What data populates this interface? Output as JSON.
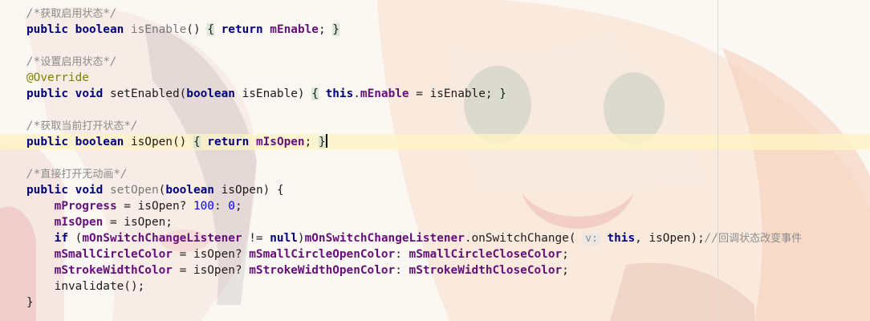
{
  "editor": {
    "language": "java",
    "current_line_index": 9,
    "lines": [
      {
        "tokens": [
          {
            "t": "/*",
            "c": "cmt"
          },
          {
            "t": "获取启用状态",
            "c": "cmt-cn"
          },
          {
            "t": "*/",
            "c": "cmt"
          }
        ]
      },
      {
        "tokens": [
          {
            "t": "public",
            "c": "kw"
          },
          {
            "t": " "
          },
          {
            "t": "boolean",
            "c": "kw"
          },
          {
            "t": " "
          },
          {
            "t": "isEnable",
            "c": "unused"
          },
          {
            "t": "() "
          },
          {
            "t": "{",
            "c": "fold"
          },
          {
            "t": " "
          },
          {
            "t": "return",
            "c": "kw"
          },
          {
            "t": " "
          },
          {
            "t": "mEnable",
            "c": "field"
          },
          {
            "t": "; "
          },
          {
            "t": "}",
            "c": "fold"
          }
        ]
      },
      {
        "tokens": []
      },
      {
        "tokens": [
          {
            "t": "/*",
            "c": "cmt"
          },
          {
            "t": "设置启用状态",
            "c": "cmt-cn"
          },
          {
            "t": "*/",
            "c": "cmt"
          }
        ]
      },
      {
        "tokens": [
          {
            "t": "@Override",
            "c": "ann"
          }
        ]
      },
      {
        "tokens": [
          {
            "t": "public",
            "c": "kw"
          },
          {
            "t": " "
          },
          {
            "t": "void",
            "c": "kw"
          },
          {
            "t": " setEnabled("
          },
          {
            "t": "boolean",
            "c": "kw"
          },
          {
            "t": " isEnable) "
          },
          {
            "t": "{",
            "c": "fold"
          },
          {
            "t": " "
          },
          {
            "t": "this",
            "c": "kw"
          },
          {
            "t": "."
          },
          {
            "t": "mEnable",
            "c": "field"
          },
          {
            "t": " = isEnable; "
          },
          {
            "t": "}",
            "c": "fold"
          }
        ]
      },
      {
        "tokens": []
      },
      {
        "tokens": [
          {
            "t": "/*",
            "c": "cmt"
          },
          {
            "t": "获取当前打开状态",
            "c": "cmt-cn"
          },
          {
            "t": "*/",
            "c": "cmt"
          }
        ]
      },
      {
        "tokens": [
          {
            "t": "public",
            "c": "kw"
          },
          {
            "t": " "
          },
          {
            "t": "boolean",
            "c": "kw"
          },
          {
            "t": " isOpen() "
          },
          {
            "t": "{",
            "c": "fold"
          },
          {
            "t": " "
          },
          {
            "t": "return",
            "c": "kw"
          },
          {
            "t": " "
          },
          {
            "t": "mIsOpen",
            "c": "field"
          },
          {
            "t": "; "
          },
          {
            "t": "}",
            "c": "fold"
          },
          {
            "t": "",
            "c": "caret"
          }
        ]
      },
      {
        "tokens": []
      },
      {
        "tokens": [
          {
            "t": "/*",
            "c": "cmt"
          },
          {
            "t": "直接打开无动画",
            "c": "cmt-cn"
          },
          {
            "t": "*/",
            "c": "cmt"
          }
        ]
      },
      {
        "tokens": [
          {
            "t": "public",
            "c": "kw"
          },
          {
            "t": " "
          },
          {
            "t": "void",
            "c": "kw"
          },
          {
            "t": " "
          },
          {
            "t": "setOpen",
            "c": "unused"
          },
          {
            "t": "("
          },
          {
            "t": "boolean",
            "c": "kw"
          },
          {
            "t": " isOpen) {"
          }
        ]
      },
      {
        "tokens": [
          {
            "t": "    "
          },
          {
            "t": "mProgress",
            "c": "field"
          },
          {
            "t": " = isOpen? "
          },
          {
            "t": "100",
            "c": "num"
          },
          {
            "t": ": "
          },
          {
            "t": "0",
            "c": "num"
          },
          {
            "t": ";"
          }
        ]
      },
      {
        "tokens": [
          {
            "t": "    "
          },
          {
            "t": "mIsOpen",
            "c": "field"
          },
          {
            "t": " = isOpen;"
          }
        ]
      },
      {
        "tokens": [
          {
            "t": "    "
          },
          {
            "t": "if",
            "c": "kw"
          },
          {
            "t": " ("
          },
          {
            "t": "mOnSwitchChangeListener",
            "c": "field"
          },
          {
            "t": " != "
          },
          {
            "t": "null",
            "c": "kw"
          },
          {
            "t": ")"
          },
          {
            "t": "mOnSwitchChangeListener",
            "c": "field"
          },
          {
            "t": ".onSwitchChange( "
          },
          {
            "t": "v:",
            "c": "hint"
          },
          {
            "t": " "
          },
          {
            "t": "this",
            "c": "kw"
          },
          {
            "t": ", isOpen);"
          },
          {
            "t": "//",
            "c": "cmt"
          },
          {
            "t": "回调状态改变事件",
            "c": "cmt-cn"
          }
        ]
      },
      {
        "tokens": [
          {
            "t": "    "
          },
          {
            "t": "mSmallCircleColor",
            "c": "field"
          },
          {
            "t": " = isOpen? "
          },
          {
            "t": "mSmallCircleOpenColor",
            "c": "field"
          },
          {
            "t": ": "
          },
          {
            "t": "mSmallCircleCloseColor",
            "c": "field"
          },
          {
            "t": ";"
          }
        ]
      },
      {
        "tokens": [
          {
            "t": "    "
          },
          {
            "t": "mStrokeWidthColor",
            "c": "field"
          },
          {
            "t": " = isOpen? "
          },
          {
            "t": "mStrokeWidthOpenColor",
            "c": "field"
          },
          {
            "t": ": "
          },
          {
            "t": "mStrokeWidthCloseColor",
            "c": "field"
          },
          {
            "t": ";"
          }
        ]
      },
      {
        "tokens": [
          {
            "t": "    invalidate();"
          }
        ]
      },
      {
        "tokens": [
          {
            "t": "}"
          }
        ]
      }
    ]
  },
  "colors": {
    "keyword": "#000080",
    "field": "#660e7a",
    "number": "#0000ff",
    "annotation": "#808000",
    "comment": "#8c8c8c",
    "current_line": "#fff4c4"
  }
}
